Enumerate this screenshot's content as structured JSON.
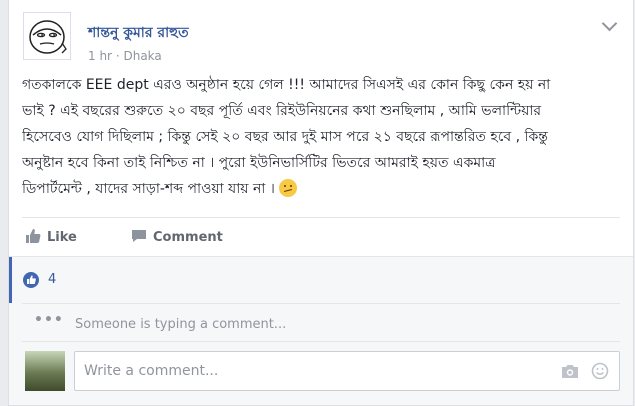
{
  "post": {
    "author": "শান্তনু কুমার রাহুত",
    "time": "1 hr",
    "separator": "·",
    "location": "Dhaka",
    "lines": [
      "গতকালকে EEE dept এরও অনুষ্ঠান হয়ে গেল !!! আমাদের সিএসই এর কোন কিছু কেন হয় না",
      "ভাই ? এই বছরের শুরুতে ২০ বছর পূর্তি এবং রিইউনিয়নের কথা শুনছিলাম , আমি ভলান্টিয়ার",
      "হিসেবেও যোগ দিছিলাম ; কিন্তু সেই ২০ বছর আর দুই মাস পরে ২১ বছরে রূপান্তরিত হবে , কিন্তু",
      "অনুষ্টান হবে কিনা তাই নিশ্চিত না । পুরো ইউনিভার্সিটির ভিতরে আমরাই হয়ত একমাত্র",
      "ডিপার্টমেন্ট , যাদের সাড়া-শব্দ পাওয়া যায় না ।"
    ],
    "emoji": "confused-face"
  },
  "actions": {
    "like_label": "Like",
    "comment_label": "Comment"
  },
  "reactions": {
    "like_count": "4"
  },
  "typing_indicator": "Someone is typing a comment...",
  "comment_input": {
    "placeholder": "Write a comment..."
  },
  "colors": {
    "link": "#365899",
    "accent": "#4267b2",
    "muted": "#90949c",
    "text": "#1d2129",
    "background": "#e9ebee"
  }
}
